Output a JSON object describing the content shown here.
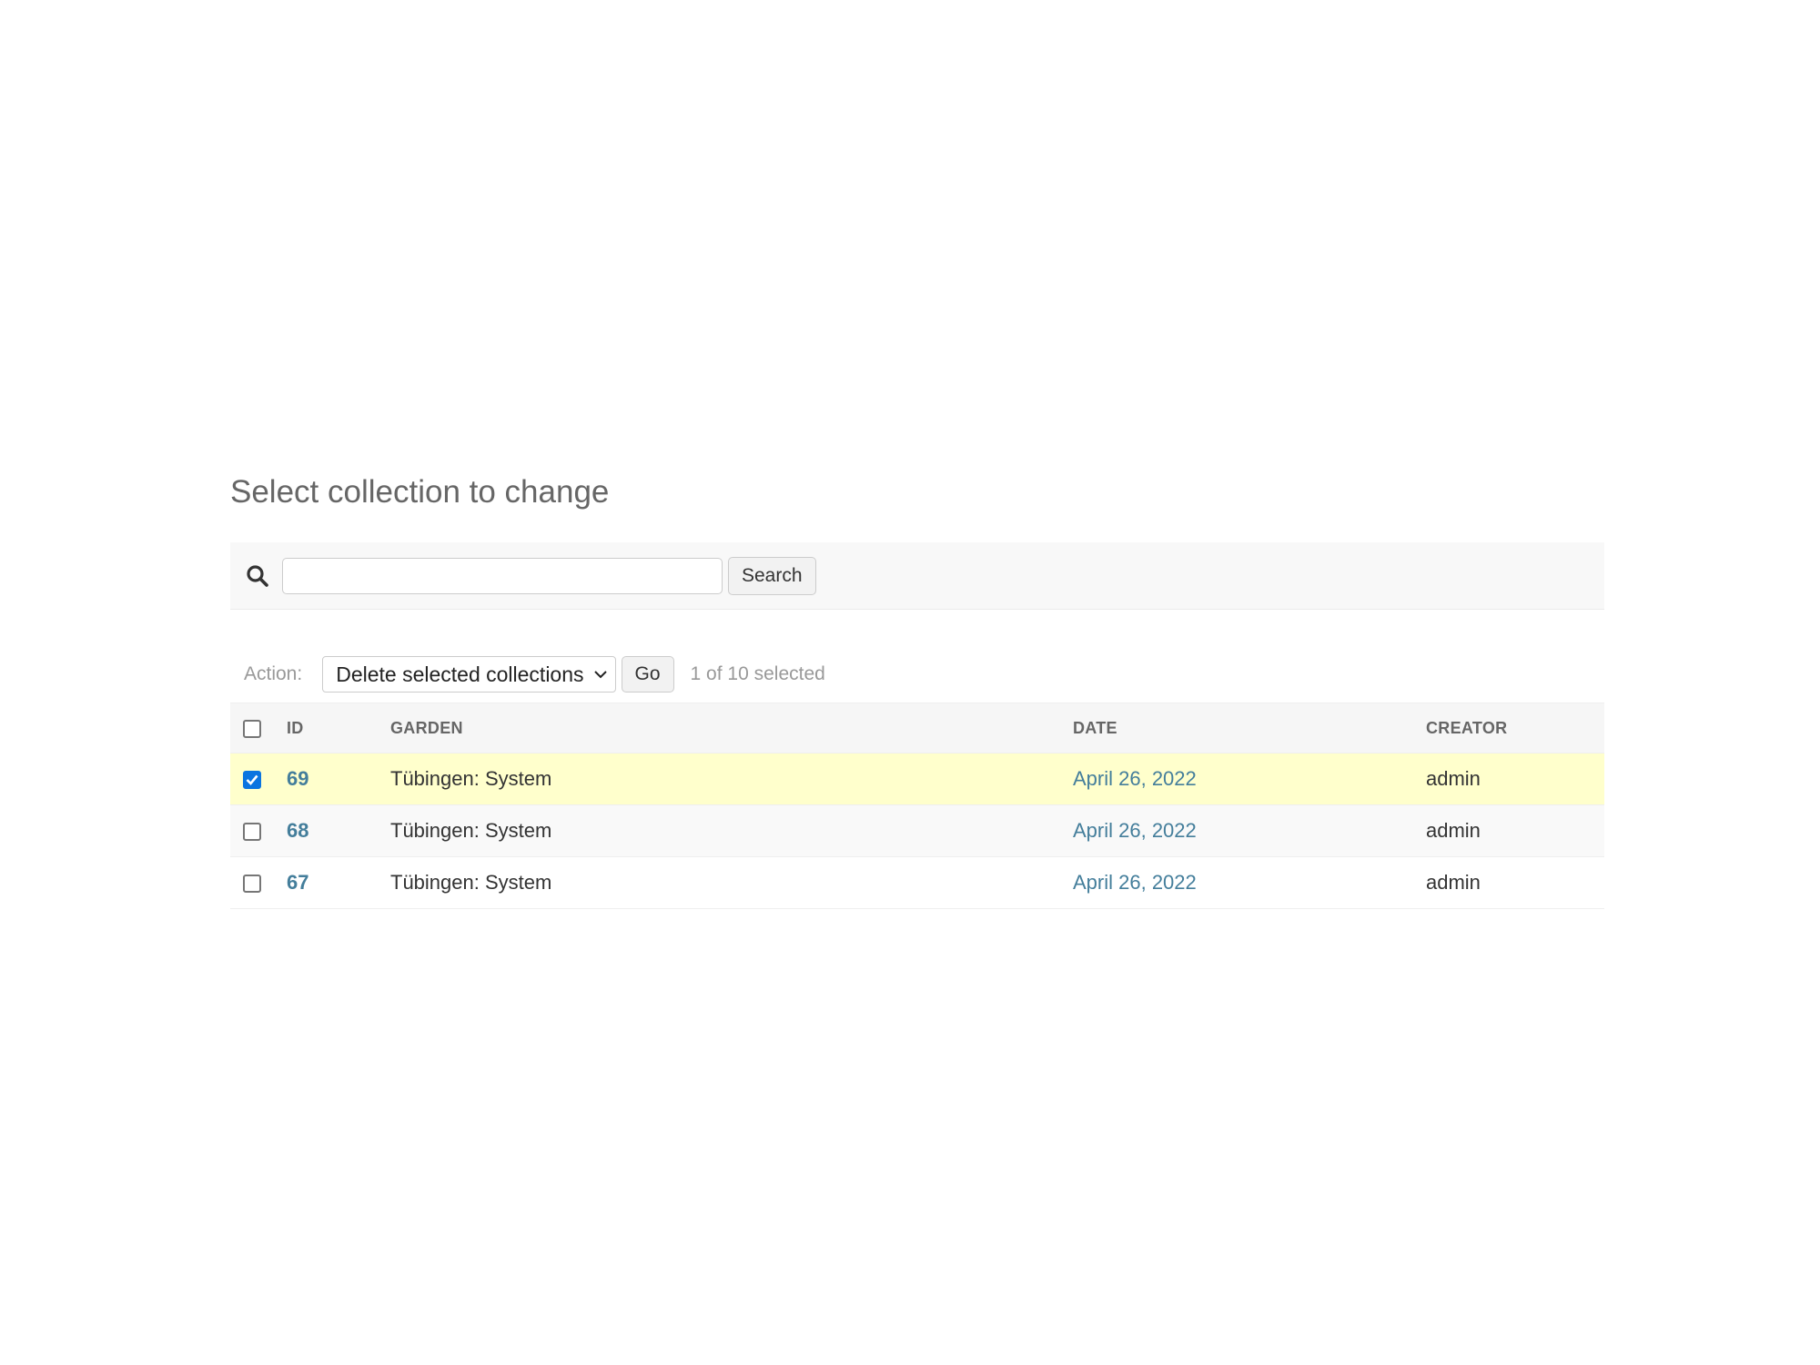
{
  "page": {
    "title": "Select collection to change"
  },
  "search": {
    "value": "",
    "placeholder": "",
    "button_label": "Search"
  },
  "actions": {
    "label": "Action:",
    "selected_action": "Delete selected collections",
    "go_label": "Go",
    "counter": "1 of 10 selected"
  },
  "table": {
    "columns": [
      "ID",
      "GARDEN",
      "DATE",
      "CREATOR"
    ],
    "rows": [
      {
        "id": "69",
        "garden": "Tübingen: System",
        "date": "April 26, 2022",
        "creator": "admin",
        "selected": true
      },
      {
        "id": "68",
        "garden": "Tübingen: System",
        "date": "April 26, 2022",
        "creator": "admin",
        "selected": false
      },
      {
        "id": "67",
        "garden": "Tübingen: System",
        "date": "April 26, 2022",
        "creator": "admin",
        "selected": false
      }
    ]
  },
  "colors": {
    "link": "#447e9b",
    "selected_row": "#ffffcc",
    "checkbox_checked": "#0b75e0"
  },
  "icons": {
    "search": "search-icon",
    "select_chevron": "chevron-down-icon"
  }
}
